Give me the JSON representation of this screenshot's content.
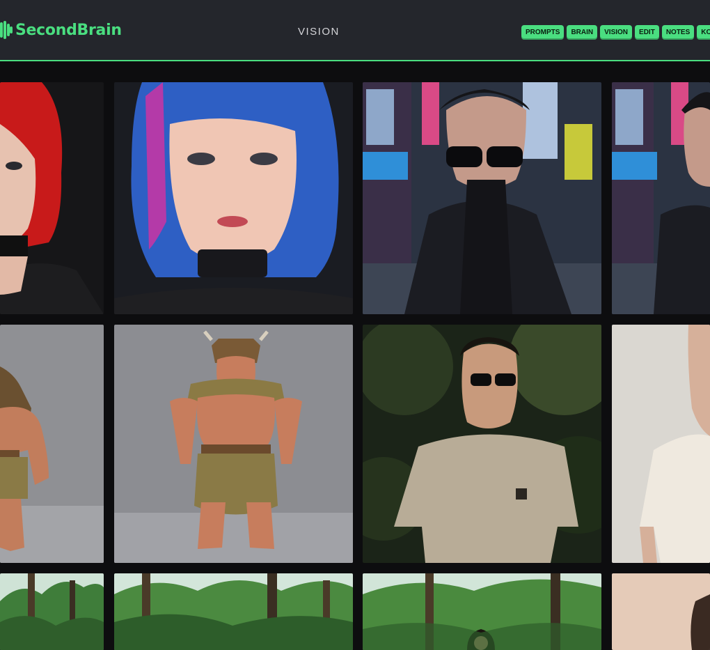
{
  "app": {
    "logo_text": "SecondBrain",
    "page_title": "VISION"
  },
  "nav": {
    "items": [
      "PROMPTS",
      "BRAIN",
      "VISION",
      "EDIT",
      "NOTES",
      "KOM"
    ]
  },
  "colors": {
    "accent": "#4ade80",
    "header_bg": "#24262c",
    "page_bg": "#0d0d0f"
  },
  "gallery": {
    "tiles": [
      {
        "row": 0,
        "col": 0,
        "icon": "portrait-red-hair-woman-image"
      },
      {
        "row": 0,
        "col": 1,
        "icon": "portrait-blue-hair-woman-image"
      },
      {
        "row": 0,
        "col": 2,
        "icon": "cyberpunk-man-sunglasses-image"
      },
      {
        "row": 0,
        "col": 3,
        "icon": "cyberpunk-man-sunglasses-image"
      },
      {
        "row": 1,
        "col": 0,
        "icon": "barbarian-dwarf-figure-image"
      },
      {
        "row": 1,
        "col": 1,
        "icon": "barbarian-dwarf-figure-image"
      },
      {
        "row": 1,
        "col": 2,
        "icon": "man-jungle-tshirt-image"
      },
      {
        "row": 1,
        "col": 3,
        "icon": "man-white-tshirt-image"
      },
      {
        "row": 2,
        "col": 0,
        "icon": "jungle-scene-image"
      },
      {
        "row": 2,
        "col": 1,
        "icon": "jungle-scene-image"
      },
      {
        "row": 2,
        "col": 2,
        "icon": "jungle-woman-image"
      },
      {
        "row": 2,
        "col": 3,
        "icon": "portrait-beige-image"
      }
    ]
  }
}
